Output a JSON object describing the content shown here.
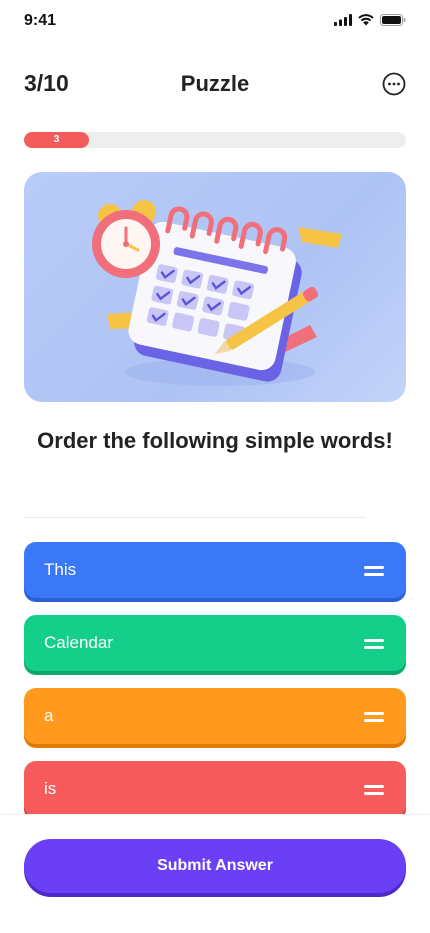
{
  "status_bar": {
    "time": "9:41",
    "icons": [
      "signal-icon",
      "wifi-icon",
      "battery-icon"
    ]
  },
  "header": {
    "progress_count": "3/10",
    "title": "Puzzle",
    "menu_icon": "more-icon"
  },
  "progress": {
    "current": 3,
    "total": 10,
    "fraction": 0.17,
    "label": "3",
    "color": "#f45b5b"
  },
  "hero": {
    "illustration": "calendar-clock-pencil-illustration"
  },
  "question": {
    "text": "Order the following simple words!"
  },
  "answers": [
    {
      "label": "This",
      "color": "#3b78f7",
      "shadow": "#2a5fd6"
    },
    {
      "label": "Calendar",
      "color": "#13cf8a",
      "shadow": "#0aa86c"
    },
    {
      "label": "a",
      "color": "#ff9a1f",
      "shadow": "#e07a05"
    },
    {
      "label": "is",
      "color": "#f75b5b",
      "shadow": "#d43f3f"
    }
  ],
  "submit": {
    "label": "Submit Answer",
    "color": "#6a3ff5"
  }
}
